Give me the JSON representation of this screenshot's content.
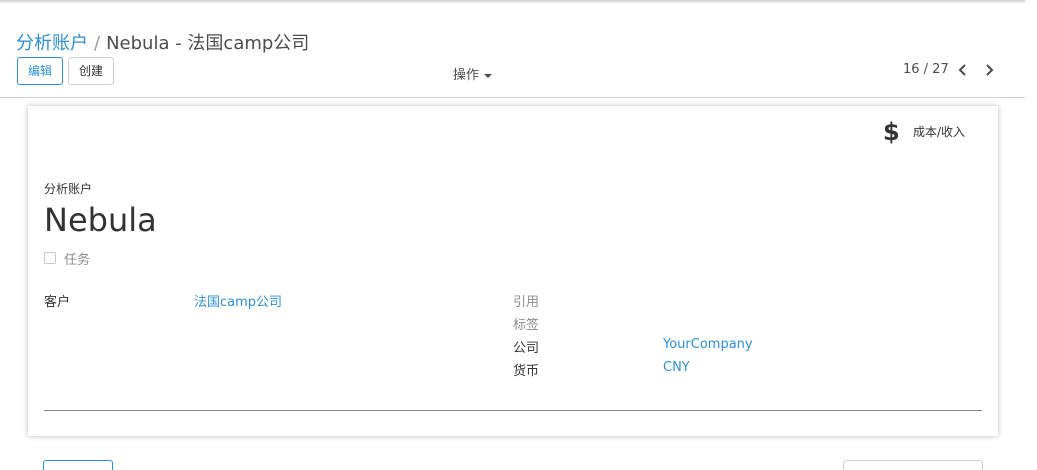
{
  "breadcrumb": {
    "parent": "分析账户",
    "separator": "/",
    "current": "Nebula - 法国camp公司"
  },
  "toolbar": {
    "edit_label": "编辑",
    "create_label": "创建",
    "action_label": "操作"
  },
  "pager": {
    "text": "16 / 27",
    "prev_icon": "chevron-left-icon",
    "next_icon": "chevron-right-icon"
  },
  "smart_button": {
    "icon": "dollar-icon",
    "symbol": "$",
    "label": "成本/收入"
  },
  "record": {
    "caption": "分析账户",
    "name": "Nebula",
    "task_label": "任务",
    "task_checked": false
  },
  "fields_left": {
    "customer_label": "客户",
    "customer_value": "法国camp公司"
  },
  "fields_right": {
    "reference_label": "引用",
    "tags_label": "标签",
    "company_label": "公司",
    "company_value": "YourCompany",
    "currency_label": "货币",
    "currency_value": "CNY"
  },
  "colors": {
    "link": "#2e8fd6",
    "text": "#4c4c4c",
    "muted": "#8d8d8d",
    "border": "#cfcfcf"
  }
}
